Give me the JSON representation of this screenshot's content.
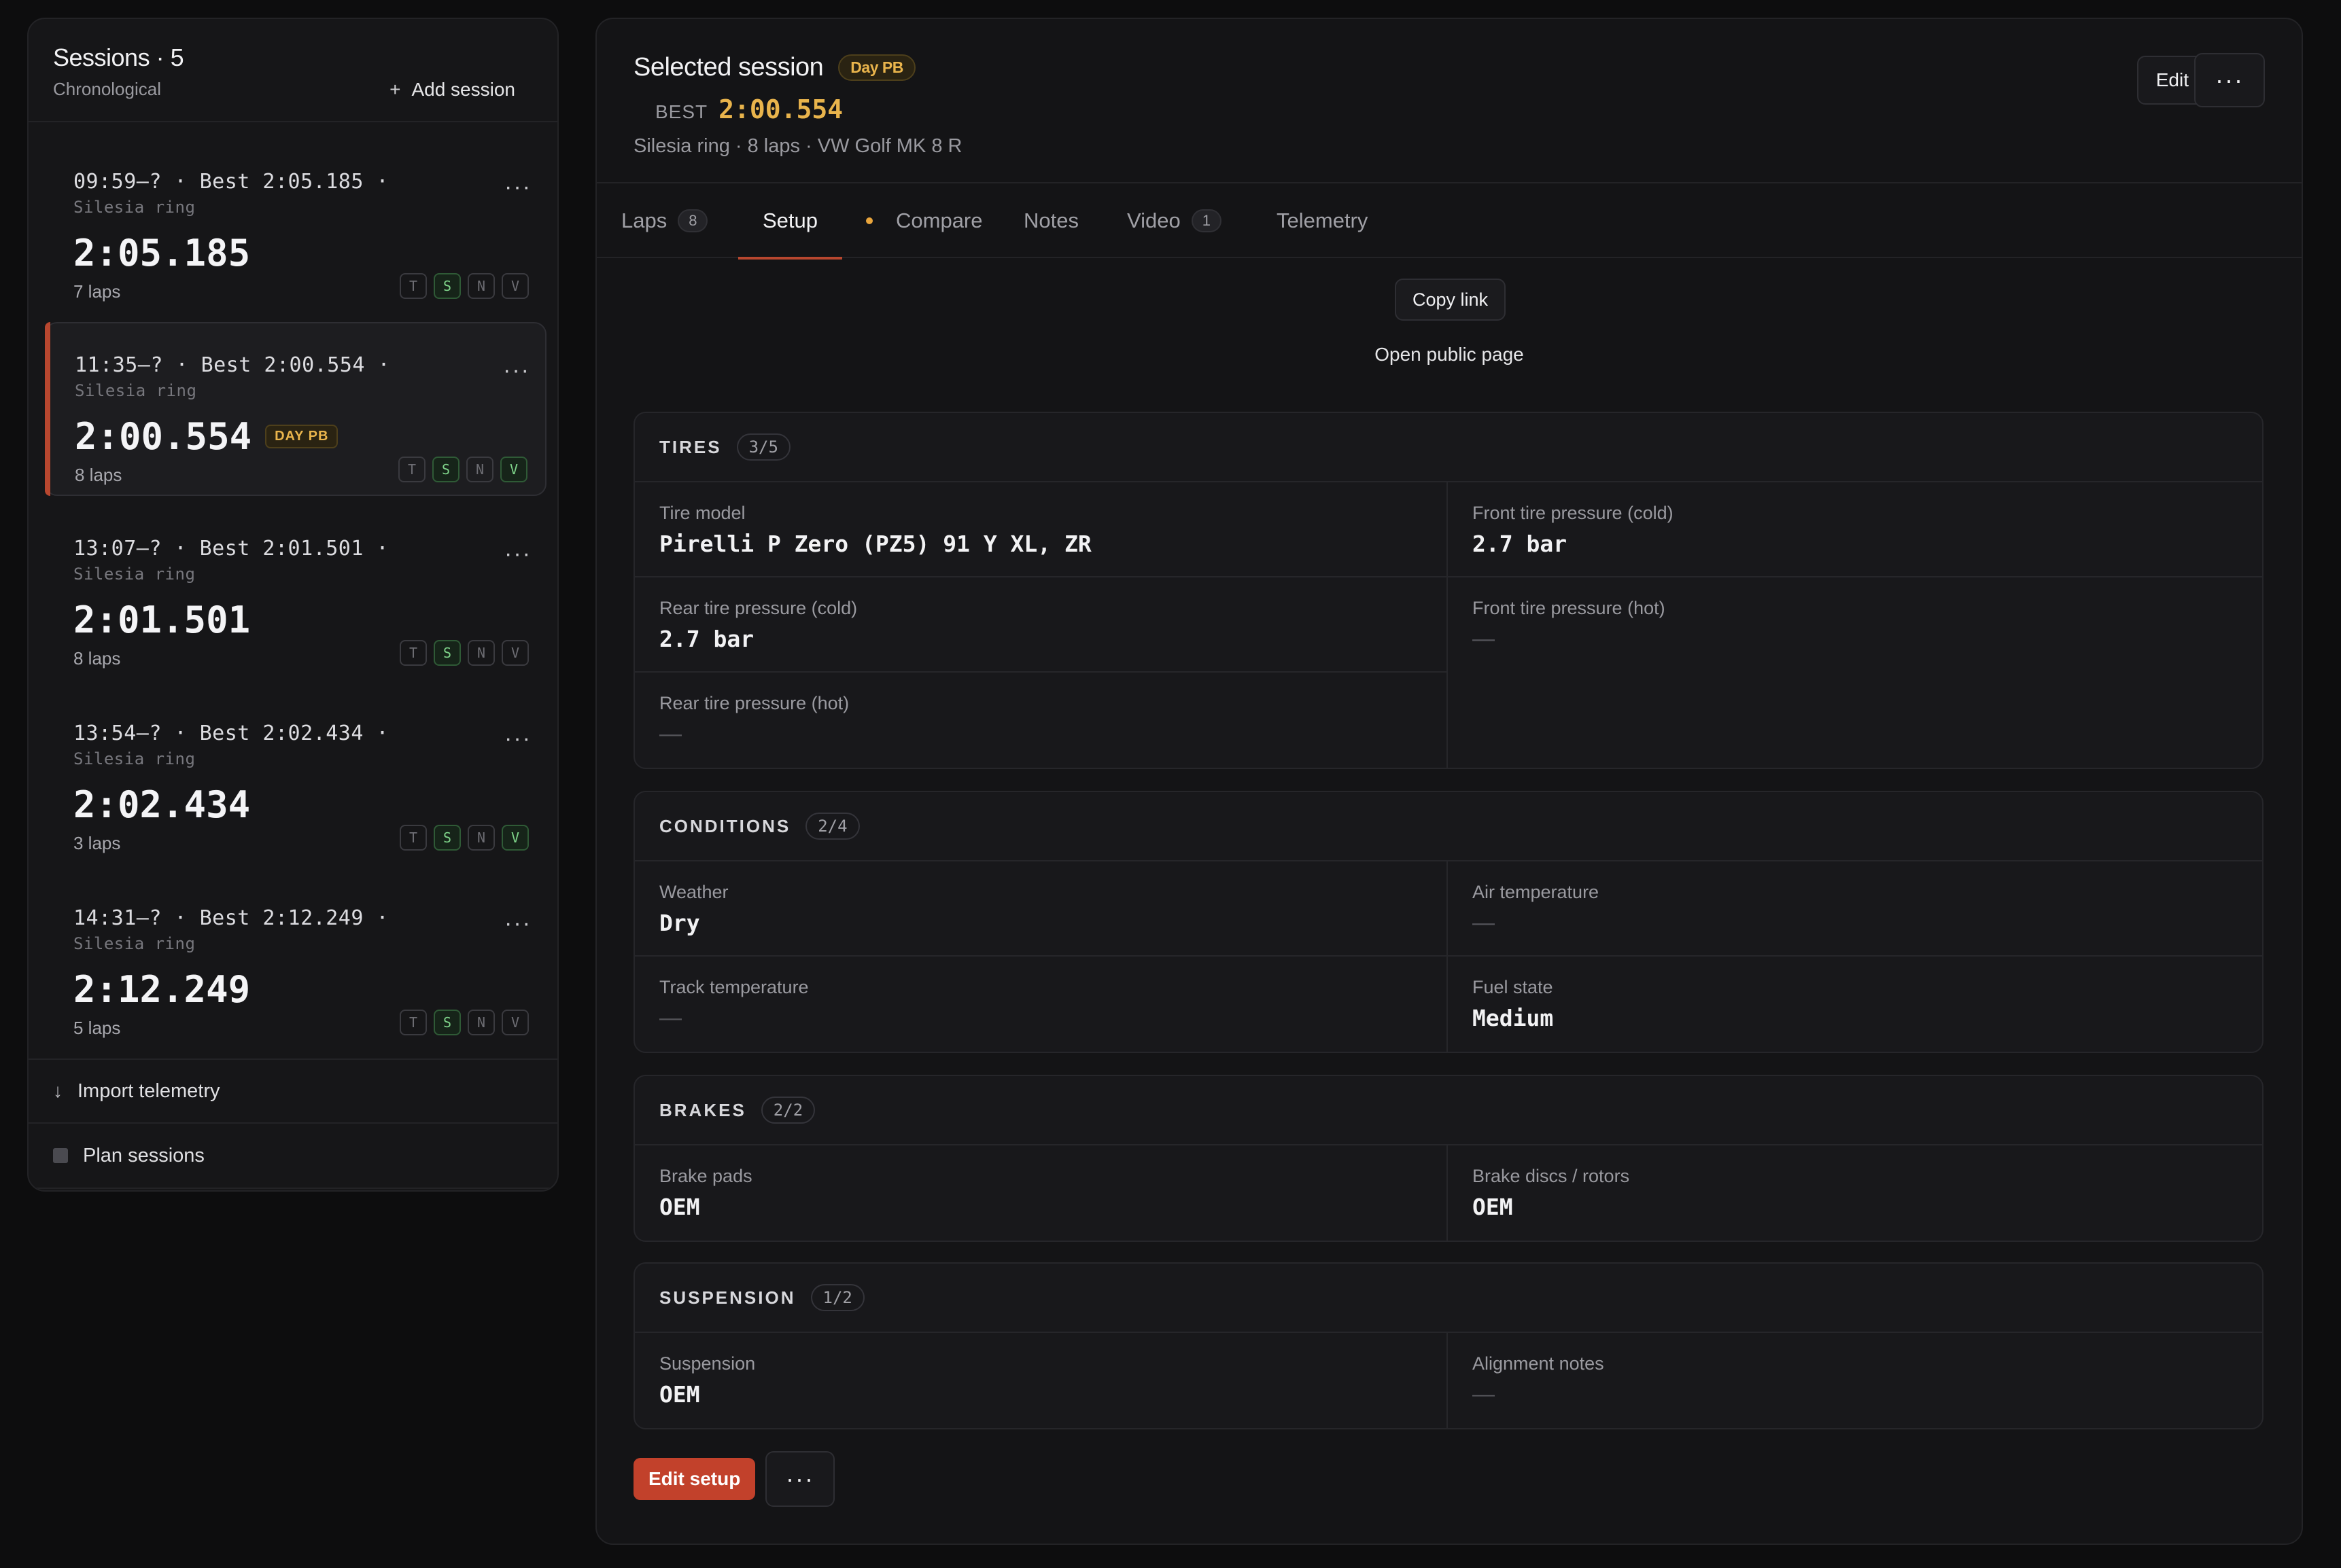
{
  "sidebar": {
    "title": "Sessions · 5",
    "subtitle": "Chronological",
    "add_session_label": "Add session",
    "sessions": [
      {
        "line": "09:59–? · Best 2:05.185 ·",
        "track": "Silesia ring",
        "time": "2:05.185",
        "laps": "7 laps",
        "badge": "",
        "tags": [
          "T",
          "S",
          "N",
          "V"
        ],
        "tags_on": [
          false,
          true,
          false,
          false
        ]
      },
      {
        "line": "11:35–? · Best 2:00.554 ·",
        "track": "Silesia ring",
        "time": "2:00.554",
        "laps": "8 laps",
        "badge": "DAY PB",
        "tags": [
          "T",
          "S",
          "N",
          "V"
        ],
        "tags_on": [
          false,
          true,
          false,
          true
        ]
      },
      {
        "line": "13:07–? · Best 2:01.501 ·",
        "track": "Silesia ring",
        "time": "2:01.501",
        "laps": "8 laps",
        "badge": "",
        "tags": [
          "T",
          "S",
          "N",
          "V"
        ],
        "tags_on": [
          false,
          true,
          false,
          false
        ]
      },
      {
        "line": "13:54–? · Best 2:02.434 ·",
        "track": "Silesia ring",
        "time": "2:02.434",
        "laps": "3 laps",
        "badge": "",
        "tags": [
          "T",
          "S",
          "N",
          "V"
        ],
        "tags_on": [
          false,
          true,
          false,
          true
        ]
      },
      {
        "line": "14:31–? · Best 2:12.249 ·",
        "track": "Silesia ring",
        "time": "2:12.249",
        "laps": "5 laps",
        "badge": "",
        "tags": [
          "T",
          "S",
          "N",
          "V"
        ],
        "tags_on": [
          false,
          true,
          false,
          false
        ]
      }
    ],
    "more_glyph": "···",
    "import_label": "Import telemetry",
    "plan_label": "Plan sessions"
  },
  "header": {
    "title": "Selected session",
    "badge": "Day PB",
    "best_label": "BEST",
    "best_value": "2:00.554",
    "meta": "Silesia ring · 8 laps · VW Golf MK 8 R",
    "edit_label": "Edit",
    "more_glyph": "···"
  },
  "tabs": [
    {
      "label": "Laps",
      "count": "8"
    },
    {
      "label": "Setup",
      "count": ""
    },
    {
      "label": "Compare",
      "count": ""
    },
    {
      "label": "Notes",
      "count": ""
    },
    {
      "label": "Video",
      "count": "1"
    },
    {
      "label": "Telemetry",
      "count": ""
    }
  ],
  "share": {
    "copy_link_label": "Copy link",
    "public_page_label": "Open public page"
  },
  "sections": {
    "tires": {
      "title": "TIRES",
      "count": "3/5",
      "fields": [
        {
          "label": "Tire model",
          "value": "Pirelli P Zero (PZ5) 91 Y XL, ZR"
        },
        {
          "label": "Front tire pressure (cold)",
          "value": "2.7 bar"
        },
        {
          "label": "Rear tire pressure (cold)",
          "value": "2.7 bar"
        },
        {
          "label": "Front tire pressure (hot)",
          "value": "—"
        },
        {
          "label": "Rear tire pressure (hot)",
          "value": "—"
        }
      ]
    },
    "conditions": {
      "title": "CONDITIONS",
      "count": "2/4",
      "fields": [
        {
          "label": "Weather",
          "value": "Dry"
        },
        {
          "label": "Air temperature",
          "value": "—"
        },
        {
          "label": "Track temperature",
          "value": "—"
        },
        {
          "label": "Fuel state",
          "value": "Medium"
        }
      ]
    },
    "brakes": {
      "title": "BRAKES",
      "count": "2/2",
      "fields": [
        {
          "label": "Brake pads",
          "value": "OEM"
        },
        {
          "label": "Brake discs / rotors",
          "value": "OEM"
        }
      ]
    },
    "suspension": {
      "title": "SUSPENSION",
      "count": "1/2",
      "fields": [
        {
          "label": "Suspension",
          "value": "OEM"
        },
        {
          "label": "Alignment notes",
          "value": "—"
        }
      ]
    }
  },
  "footer": {
    "edit_setup_label": "Edit setup",
    "more_glyph": "···"
  },
  "colors": {
    "accent": "#b8472f",
    "gold": "#e9b44c",
    "tag_on": "#7fd48a"
  }
}
